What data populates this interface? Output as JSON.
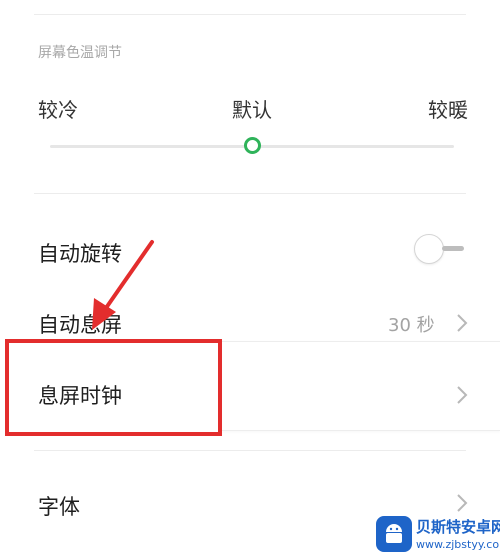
{
  "display_settings": {
    "color_temperature": {
      "header": "屏幕色温调节",
      "labels": {
        "cool": "较冷",
        "default": "默认",
        "warm": "较暖"
      },
      "value": 0.5,
      "accent_color": "#2fb35a"
    },
    "rows": [
      {
        "label": "自动旋转",
        "control": "toggle",
        "toggle_on": false
      },
      {
        "label": "自动息屏",
        "value": "30 秒",
        "control": "chevron"
      },
      {
        "label": "息屏时钟",
        "control": "chevron",
        "highlighted": true
      },
      {
        "label": "字体",
        "value": "",
        "control": "chevron"
      }
    ]
  },
  "annotation": {
    "highlight_color": "#e32d2d"
  },
  "watermark": {
    "title": "贝斯特安卓网",
    "url": "www.zjbstyy.com",
    "brand_color": "#1e64c8"
  }
}
